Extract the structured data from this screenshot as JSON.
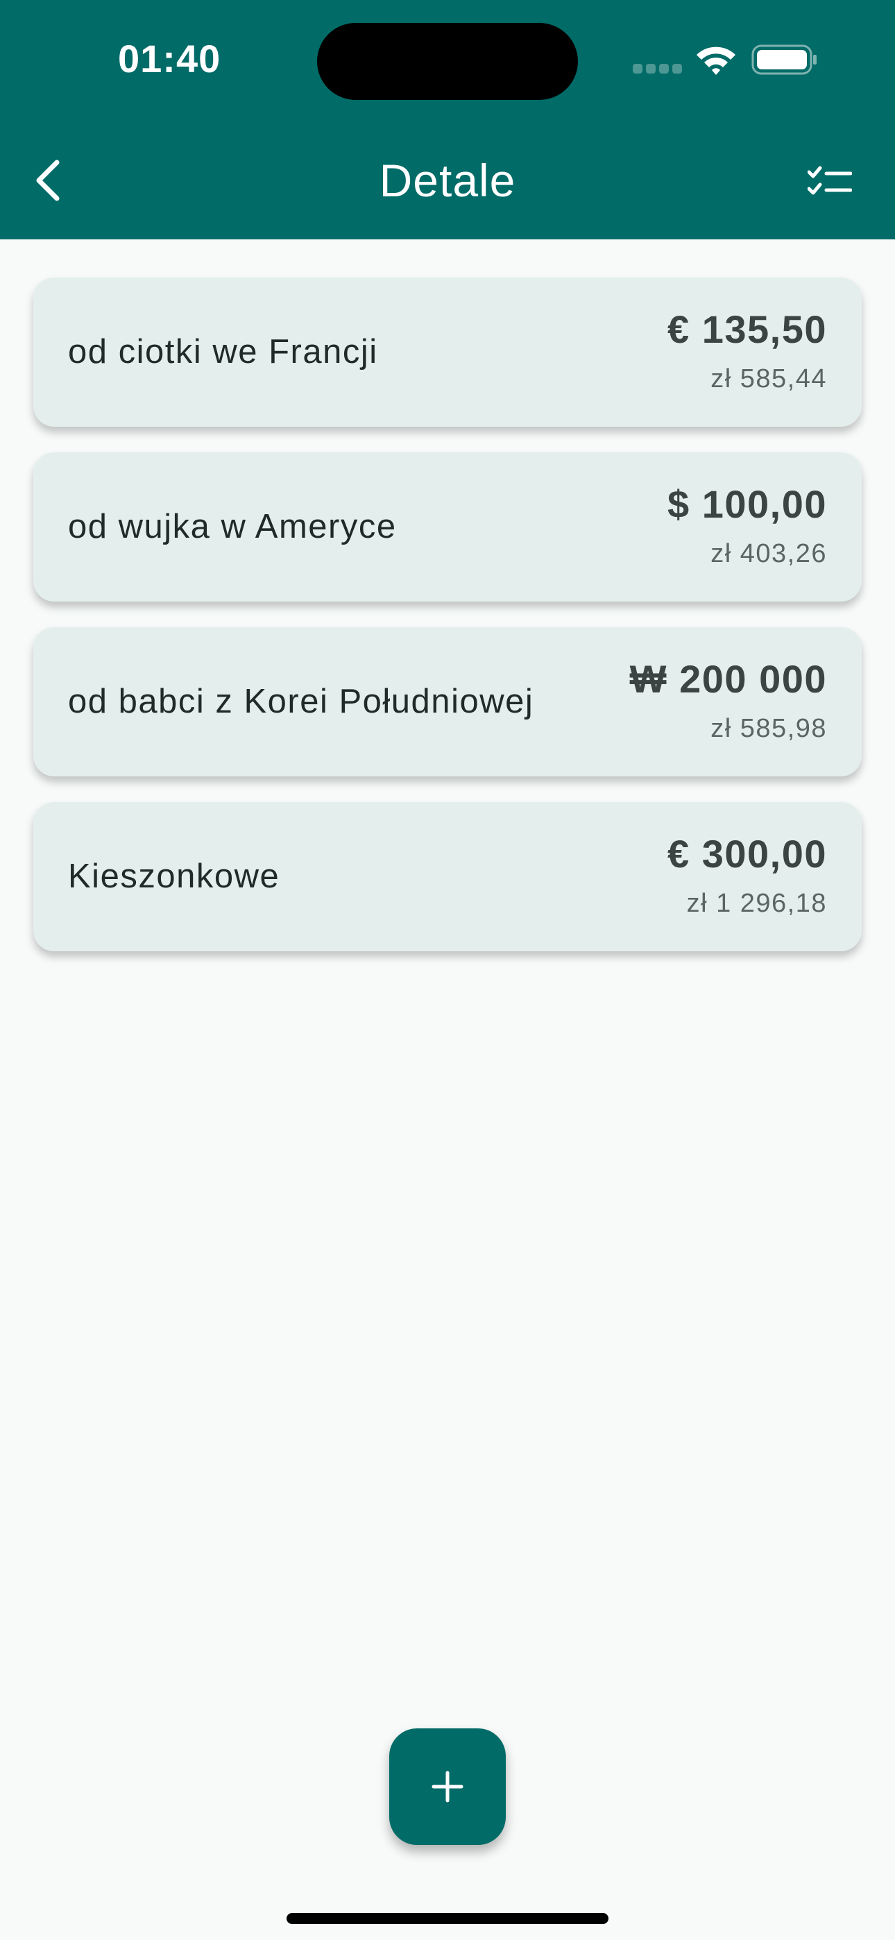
{
  "status_bar": {
    "time": "01:40",
    "icons": [
      "cellular-signal-icon",
      "wifi-icon",
      "battery-icon"
    ]
  },
  "app_bar": {
    "back_icon": "chevron-left-icon",
    "title": "Detale",
    "action_icon": "checklist-icon"
  },
  "entries": [
    {
      "label": "od ciotki we Francji",
      "amount": "€ 135,50",
      "converted": "zł 585,44"
    },
    {
      "label": "od wujka w Ameryce",
      "amount": "$ 100,00",
      "converted": "zł 403,26"
    },
    {
      "label": "od babci z Korei Południowej",
      "amount": "₩ 200 000",
      "converted": "zł 585,98"
    },
    {
      "label": "Kieszonkowe",
      "amount": "€ 300,00",
      "converted": "zł 1 296,18"
    }
  ],
  "fab": {
    "icon": "plus-icon"
  },
  "colors": {
    "primary": "#016b67",
    "card_background": "#e4eeed",
    "page_background": "#f7faf9"
  }
}
